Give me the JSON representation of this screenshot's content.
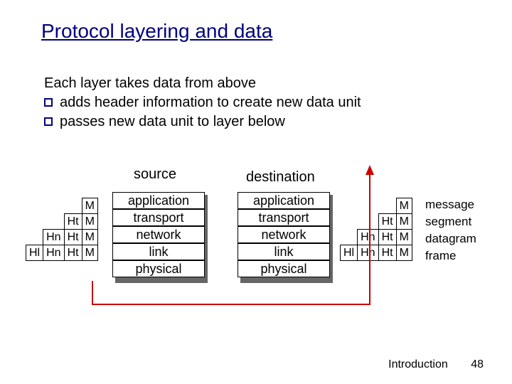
{
  "title": "Protocol layering and data",
  "intro": {
    "line1": "Each layer takes data from above",
    "b1": "adds header information to create new data unit",
    "b2": "passes new data unit to layer below"
  },
  "columns": {
    "source": "source",
    "destination": "destination"
  },
  "layers": {
    "l0": "application",
    "l1": "transport",
    "l2": "network",
    "l3": "link",
    "l4": "physical"
  },
  "headers": {
    "M": "M",
    "Ht": "Ht",
    "Hn": "Hn",
    "Hl": "Hl"
  },
  "pdu": {
    "message": "message",
    "segment": "segment",
    "datagram": "datagram",
    "frame": "frame"
  },
  "footer": {
    "section": "Introduction",
    "page": "48"
  }
}
